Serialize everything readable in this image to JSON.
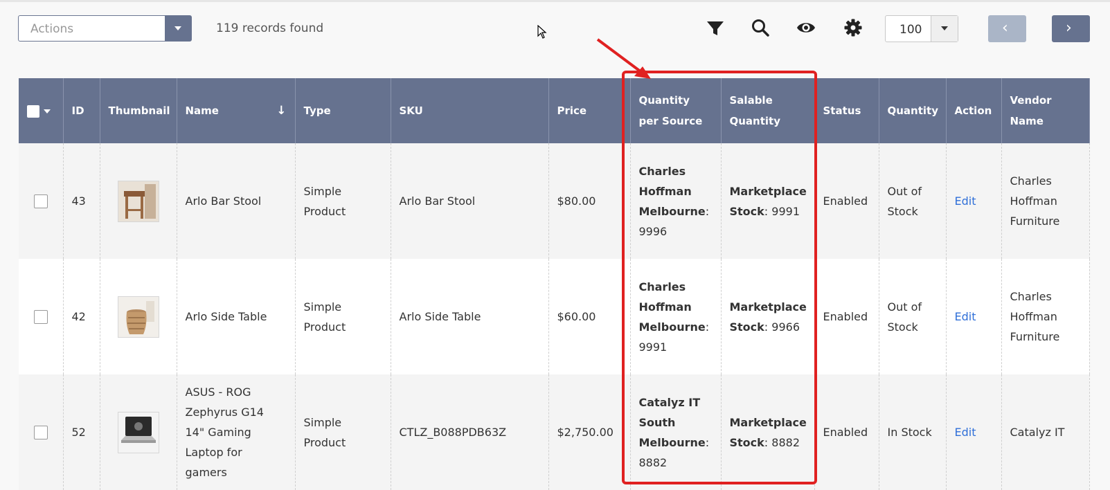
{
  "toolbar": {
    "actions_placeholder": "Actions",
    "records_found": "119 records found",
    "per_page": "100"
  },
  "icons": {
    "filter": "filter-icon",
    "search": "search-icon",
    "view": "eye-icon",
    "settings": "gear-icon",
    "prev": "chevron-left-icon",
    "next": "chevron-right-icon"
  },
  "columns": {
    "id": "ID",
    "thumbnail": "Thumbnail",
    "name": "Name",
    "type": "Type",
    "sku": "SKU",
    "price": "Price",
    "qty_per_source": "Quantity per Source",
    "salable_qty": "Salable Quantity",
    "status": "Status",
    "quantity": "Quantity",
    "action": "Action",
    "vendor": "Vendor Name"
  },
  "rows": [
    {
      "id": "43",
      "name": "Arlo Bar Stool",
      "type": "Simple Product",
      "sku": "Arlo Bar Stool",
      "price": "$80.00",
      "source_name": "Charles Hoffman Melbourne",
      "source_qty": "9996",
      "salable_name": "Marketplace Stock",
      "salable_qty": "9991",
      "status": "Enabled",
      "stock": "Out of Stock",
      "action": "Edit",
      "vendor": "Charles Hoffman Furniture"
    },
    {
      "id": "42",
      "name": "Arlo Side Table",
      "type": "Simple Product",
      "sku": "Arlo Side Table",
      "price": "$60.00",
      "source_name": "Charles Hoffman Melbourne",
      "source_qty": "9991",
      "salable_name": "Marketplace Stock",
      "salable_qty": "9966",
      "status": "Enabled",
      "stock": "Out of Stock",
      "action": "Edit",
      "vendor": "Charles Hoffman Furniture"
    },
    {
      "id": "52",
      "name": "ASUS - ROG Zephyrus G14 14\" Gaming Laptop for gamers",
      "type": "Simple Product",
      "sku": "CTLZ_B088PDB63Z",
      "price": "$2,750.00",
      "source_name": "Catalyz IT South Melbourne",
      "source_qty": "8882",
      "salable_name": "Marketplace Stock",
      "salable_qty": "8882",
      "status": "Enabled",
      "stock": "In Stock",
      "action": "Edit",
      "vendor": "Catalyz IT"
    }
  ],
  "colors": {
    "header_bg": "#66728f",
    "annotation": "#e02121",
    "link": "#2f6fd8"
  }
}
